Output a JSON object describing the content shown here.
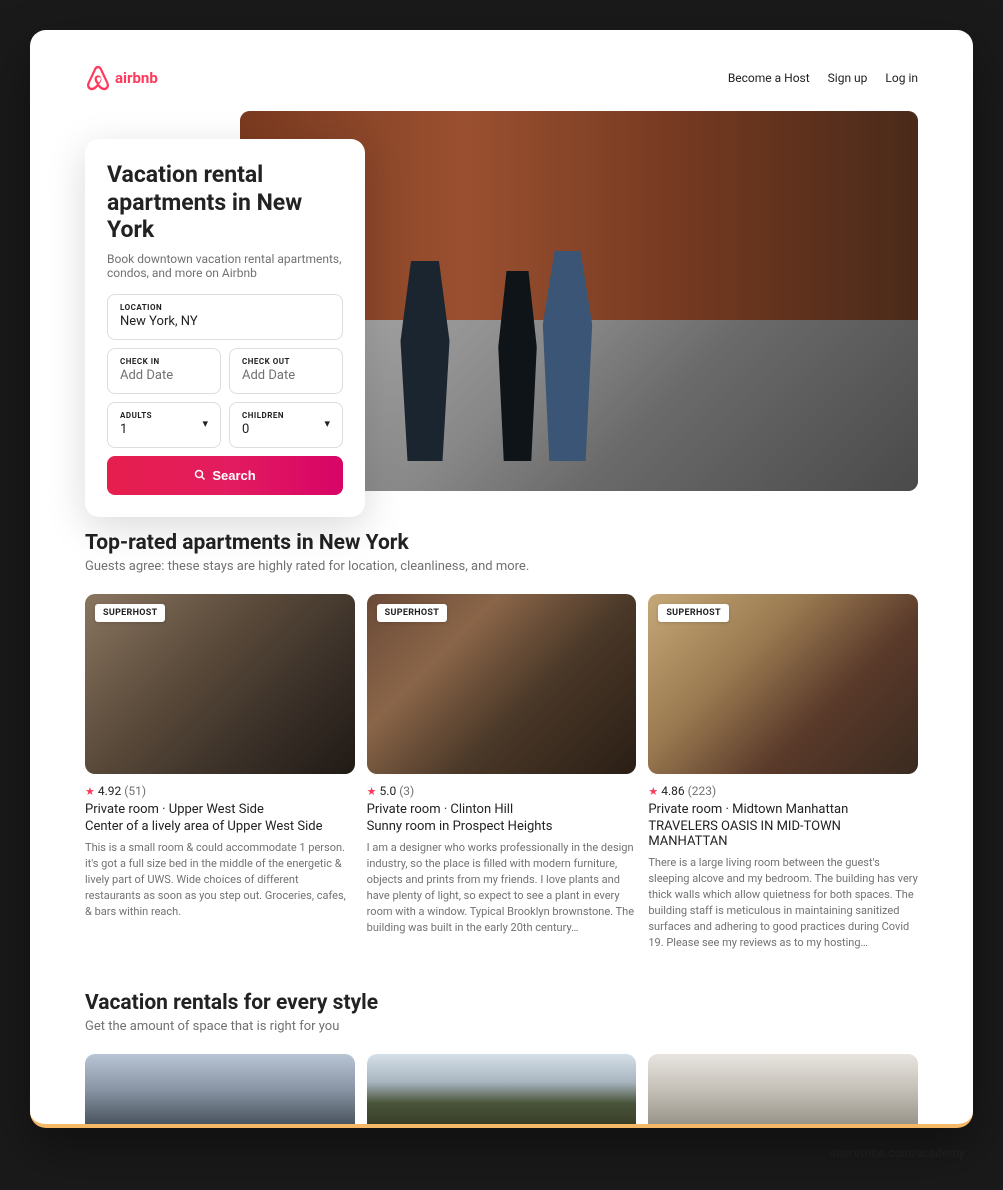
{
  "brand": {
    "name": "airbnb"
  },
  "nav": {
    "become_host": "Become a Host",
    "signup": "Sign up",
    "login": "Log in"
  },
  "hero": {
    "title": "Vacation rental apartments in New York",
    "subtitle": "Book downtown vacation rental apartments, condos, and more on Airbnb"
  },
  "search": {
    "location_label": "LOCATION",
    "location_value": "New York, NY",
    "checkin_label": "CHECK IN",
    "checkin_placeholder": "Add Date",
    "checkout_label": "CHECK OUT",
    "checkout_placeholder": "Add Date",
    "adults_label": "ADULTS",
    "adults_value": "1",
    "children_label": "CHILDREN",
    "children_value": "0",
    "button": "Search"
  },
  "top_rated": {
    "title": "Top-rated apartments in New York",
    "subtitle": "Guests agree: these stays are highly rated for location, cleanliness, and more.",
    "superhost_label": "SUPERHOST",
    "listings": [
      {
        "rating": "4.92",
        "count": "(51)",
        "location": "Private room · Upper West Side",
        "title": "Center of a lively area of Upper West Side",
        "description": "This is a small room & could accommodate 1 person. it's got a full size bed in the middle of the energetic & lively part of UWS. Wide choices of different restaurants as soon as you step out. Groceries, cafes, & bars within reach."
      },
      {
        "rating": "5.0",
        "count": "(3)",
        "location": "Private room · Clinton Hill",
        "title": "Sunny room in Prospect Heights",
        "description": "I am a designer who works professionally in the design industry, so the place is filled with modern furniture, objects and prints from my friends. I love plants and have plenty of light, so expect to see a plant in every room with a window. Typical Brooklyn brownstone. The building was built in the early 20th century…"
      },
      {
        "rating": "4.86",
        "count": "(223)",
        "location": "Private room · Midtown Manhattan",
        "title": "TRAVELERS OASIS IN MID-TOWN MANHATTAN",
        "description": "There is a large living room between the guest's sleeping alcove and my bedroom. The building has very thick walls which allow quietness for both spaces. The building staff is meticulous in maintaining sanitized surfaces and adhering to good practices during Covid 19. Please see my reviews as to my hosting…"
      }
    ]
  },
  "styles": {
    "title": "Vacation rentals for every style",
    "subtitle": "Get the amount of space that is right for you"
  },
  "attribution": "sharetribe.com/academy"
}
